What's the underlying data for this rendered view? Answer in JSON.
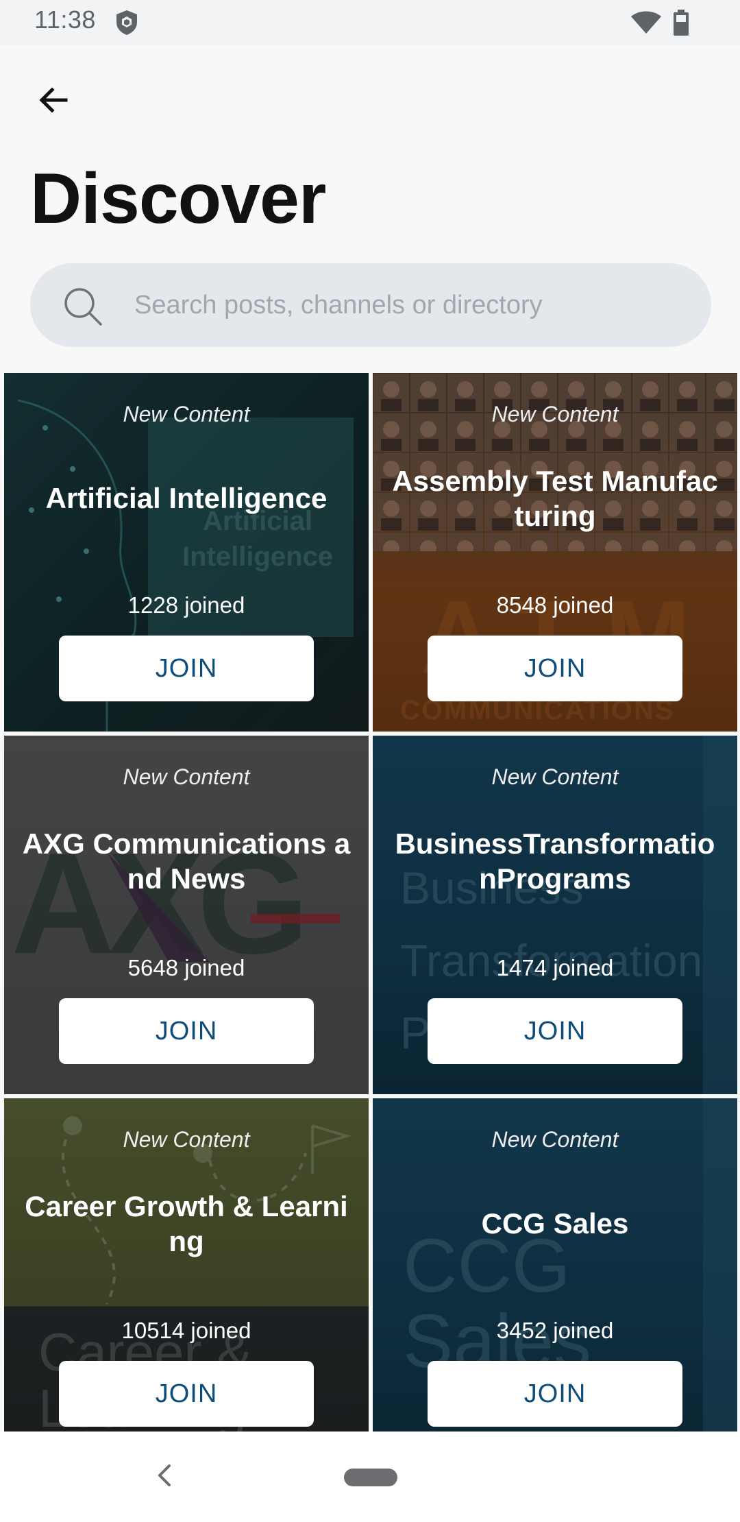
{
  "status_bar": {
    "time": "11:38",
    "icons": [
      "shield-icon",
      "wifi-icon",
      "battery-icon"
    ]
  },
  "header": {
    "back_icon": "arrow-left-icon",
    "title": "Discover"
  },
  "search": {
    "placeholder": "Search posts, channels or directory",
    "value": "",
    "icon": "search-icon"
  },
  "channels": [
    {
      "badge": "New Content",
      "title": "Artificial Intelligence",
      "joined": "1228 joined",
      "join_label": "JOIN",
      "bg_text": "Artificial Intelligence"
    },
    {
      "badge": "New Content",
      "title": "Assembly Test Manufacturing",
      "joined": "8548 joined",
      "join_label": "JOIN",
      "bg_text": "ATM",
      "bg_subtext": "COMMUNICATIONS"
    },
    {
      "badge": "New Content",
      "title": "AXG Communications and News",
      "joined": "5648 joined",
      "join_label": "JOIN",
      "bg_text": "AXG"
    },
    {
      "badge": "New Content",
      "title": "BusinessTransformationPrograms",
      "joined": "1474 joined",
      "join_label": "JOIN",
      "bg_text": "Business Transformation Programs"
    },
    {
      "badge": "New Content",
      "title": "Career Growth & Learning",
      "joined": "10514 joined",
      "join_label": "JOIN",
      "bg_text": "Career & Learning"
    },
    {
      "badge": "New Content",
      "title": "CCG Sales",
      "joined": "3452 joined",
      "join_label": "JOIN",
      "bg_text": "CCG Sales"
    }
  ],
  "nav_bar": {
    "back_icon": "nav-back-icon",
    "home_icon": "home-pill-icon"
  },
  "colors": {
    "join_text": "#0e4d7a",
    "title_text": "#111111",
    "search_bg": "#e4e7ec"
  }
}
